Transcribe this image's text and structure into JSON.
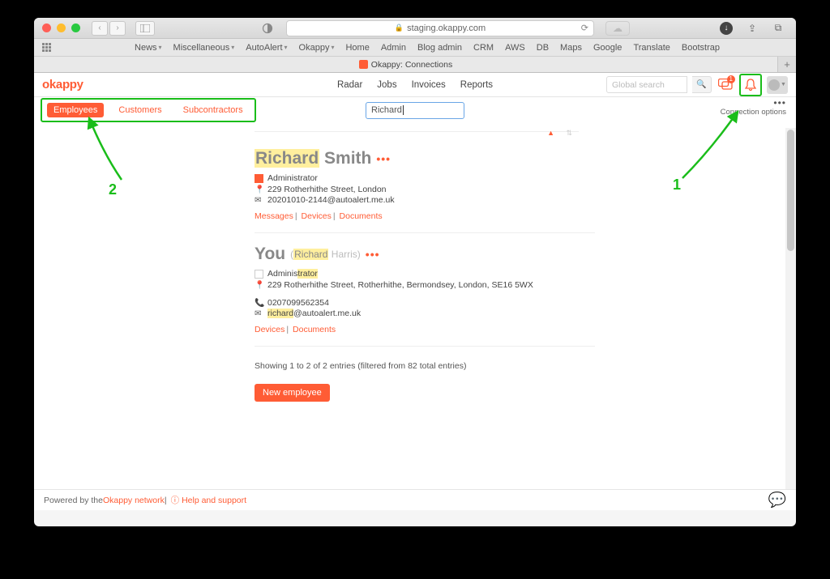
{
  "browser": {
    "url": "staging.okappy.com",
    "bookmarks": [
      "News",
      "Miscellaneous",
      "AutoAlert",
      "Okappy",
      "Home",
      "Admin",
      "Blog admin",
      "CRM",
      "AWS",
      "DB",
      "Maps",
      "Google",
      "Translate",
      "Bootstrap"
    ],
    "bookmark_has_dropdown": [
      true,
      true,
      true,
      true,
      false,
      false,
      false,
      false,
      false,
      false,
      false,
      false,
      false,
      false
    ],
    "tab_title": "Okappy: Connections"
  },
  "header": {
    "logo": "okappy",
    "nav": [
      "Radar",
      "Jobs",
      "Invoices",
      "Reports"
    ],
    "search_placeholder": "Global search",
    "notif_badge": "1"
  },
  "filter": {
    "tabs": [
      "Employees",
      "Customers",
      "Subcontractors"
    ],
    "active": 0,
    "search_value": "Richard",
    "conn_options": "Connection options"
  },
  "annotations": {
    "n1": "1",
    "n2": "2"
  },
  "entries": [
    {
      "name_hl": "Richard",
      "name_rest": " Smith",
      "role": "Administrator",
      "role_hl": false,
      "show_square": true,
      "addr_icon": true,
      "address": "229 Rotherhithe Street, London",
      "mail_icon": true,
      "email": "20201010-2144@autoalert.me.uk",
      "links": [
        "Messages",
        "Devices",
        "Documents"
      ]
    },
    {
      "you_label": "You",
      "you_sub_pre": "(",
      "you_sub_hl": "Richard",
      "you_sub_post": " Harris)",
      "role": "Administrator",
      "role_hl": true,
      "checkbox": true,
      "addr_icon": true,
      "address": "229 Rotherhithe Street, Rotherhithe, Bermondsey, London, SE16 5WX",
      "phone_icon": true,
      "phone": "0207099562354",
      "mail_icon": true,
      "email_pre_hl": "richard",
      "email_rest": "@autoalert.me.uk",
      "links": [
        "Devices",
        "Documents"
      ]
    }
  ],
  "result_count": "Showing 1 to 2 of 2 entries (filtered from 82 total entries)",
  "new_button": "New employee",
  "footer": {
    "pre": "Powered by the ",
    "link": "Okappy network",
    "sep": " | ",
    "help": "Help and support"
  }
}
